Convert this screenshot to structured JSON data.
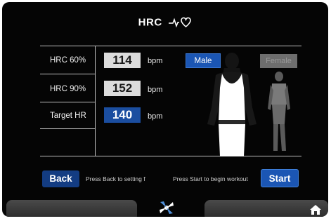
{
  "header": {
    "title": "HRC",
    "title_icon": "heart-pulse-icon"
  },
  "rows": [
    {
      "label": "HRC 60%",
      "value": "114",
      "unit": "bpm"
    },
    {
      "label": "HRC 90%",
      "value": "152",
      "unit": "bpm"
    },
    {
      "label": "Target HR",
      "value": "140",
      "unit": "bpm"
    }
  ],
  "gender": {
    "male_label": "Male",
    "female_label": "Female",
    "selected": "Male"
  },
  "footer": {
    "back_label": "Back",
    "back_hint": "Press Back to setting f",
    "start_hint": "Press Start to begin workout",
    "start_label": "Start"
  },
  "nav": {
    "fan_icon": "fan-icon",
    "home_icon": "home-icon"
  },
  "colors": {
    "accent": "#1b56b4",
    "background": "#050505"
  }
}
